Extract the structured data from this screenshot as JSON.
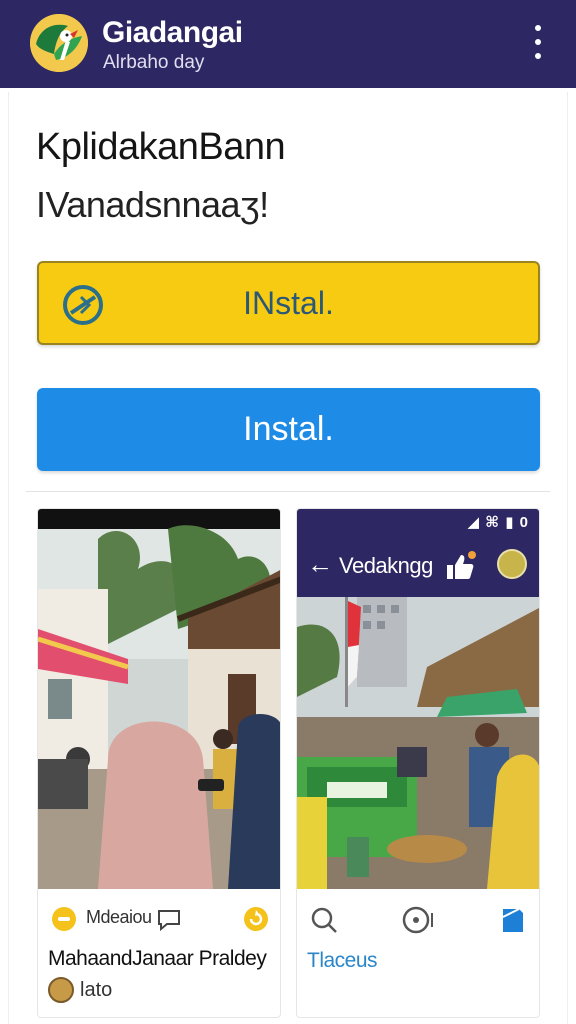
{
  "header": {
    "title": "Giadangai",
    "subtitle": "Alrbaho day",
    "logo_icon": "bird-leaf-logo-icon",
    "menu_icon": "more-vert-icon"
  },
  "main": {
    "title": "KplidakanBann",
    "subtitle": "IVanadsnnaaʒ!",
    "primary_button": {
      "label": "INstal.",
      "icon": "compass-icon",
      "color": "#f6cb12"
    },
    "secondary_button": {
      "label": "Instal.",
      "color": "#1e8ce6"
    }
  },
  "cards": {
    "left": {
      "tag": "Mdeaiou",
      "caption": "MahaandJanaar Praldey",
      "author": "lato",
      "icons": [
        "badge-icon",
        "comment-icon",
        "refresh-icon"
      ]
    },
    "right": {
      "status_bar": "◢ ⌘ ▮ 0",
      "toolbar_title": "Vedakngg",
      "caption": "Tlaceus",
      "icons": [
        "search-icon",
        "chat-icon",
        "bookmark-icon"
      ]
    }
  },
  "colors": {
    "appbar": "#2d2763",
    "accent_yellow": "#f6cb12",
    "accent_blue": "#1e8ce6",
    "link_blue": "#2b86c8"
  }
}
